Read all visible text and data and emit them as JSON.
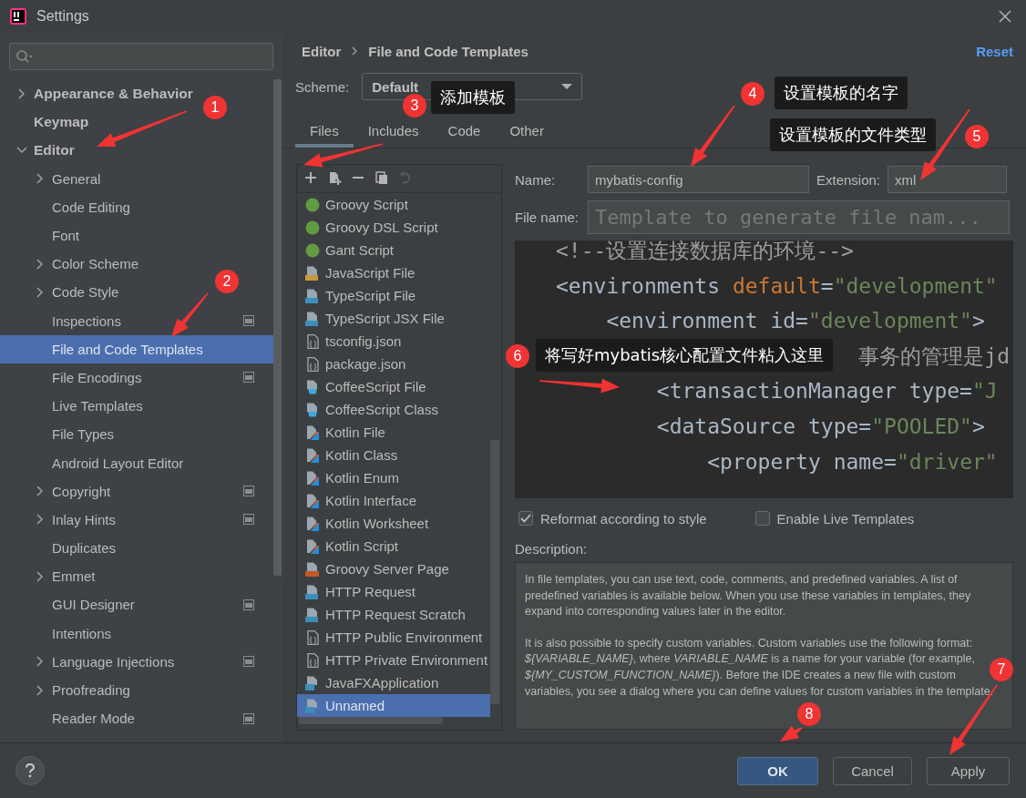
{
  "window": {
    "title": "Settings"
  },
  "sidebar": {
    "items": [
      {
        "label": "Appearance & Behavior",
        "expanded": false,
        "selected": false
      },
      {
        "label": "Keymap",
        "selected": false
      },
      {
        "label": "Editor",
        "expanded": true,
        "selected": false,
        "children": [
          {
            "label": "General",
            "expanded": false,
            "selected": false
          },
          {
            "label": "Code Editing",
            "selected": false
          },
          {
            "label": "Font",
            "selected": false
          },
          {
            "label": "Color Scheme",
            "expanded": false,
            "selected": false
          },
          {
            "label": "Code Style",
            "expanded": false,
            "selected": false
          },
          {
            "label": "Inspections",
            "selected": false,
            "project_scope": true
          },
          {
            "label": "File and Code Templates",
            "selected": true
          },
          {
            "label": "File Encodings",
            "selected": false,
            "project_scope": true
          },
          {
            "label": "Live Templates",
            "selected": false
          },
          {
            "label": "File Types",
            "selected": false
          },
          {
            "label": "Android Layout Editor",
            "selected": false
          },
          {
            "label": "Copyright",
            "expanded": false,
            "selected": false,
            "project_scope": true
          },
          {
            "label": "Inlay Hints",
            "expanded": false,
            "selected": false,
            "project_scope": true
          },
          {
            "label": "Duplicates",
            "selected": false
          },
          {
            "label": "Emmet",
            "expanded": false,
            "selected": false
          },
          {
            "label": "GUI Designer",
            "selected": false,
            "project_scope": true
          },
          {
            "label": "Intentions",
            "selected": false
          },
          {
            "label": "Language Injections",
            "expanded": false,
            "selected": false,
            "project_scope": true
          },
          {
            "label": "Proofreading",
            "expanded": false,
            "selected": false
          },
          {
            "label": "Reader Mode",
            "selected": false,
            "project_scope": true
          }
        ]
      }
    ]
  },
  "breadcrumb": [
    "Editor",
    "File and Code Templates"
  ],
  "reset": "Reset",
  "scheme": {
    "label": "Scheme:",
    "value": "Default"
  },
  "tabs": [
    {
      "label": "Files",
      "selected": true
    },
    {
      "label": "Includes",
      "selected": false
    },
    {
      "label": "Code",
      "selected": false
    },
    {
      "label": "Other",
      "selected": false
    }
  ],
  "toolbar": [
    {
      "kind": "add",
      "disabled": false
    },
    {
      "kind": "add-child",
      "disabled": false
    },
    {
      "kind": "remove",
      "disabled": false
    },
    {
      "kind": "copy",
      "disabled": false
    },
    {
      "kind": "reset",
      "disabled": true
    }
  ],
  "templates": [
    {
      "label": "Groovy Script",
      "kind": "groovy",
      "selected": false
    },
    {
      "label": "Groovy DSL Script",
      "kind": "groovy",
      "selected": false
    },
    {
      "label": "Gant Script",
      "kind": "groovy",
      "selected": false
    },
    {
      "label": "JavaScript File",
      "kind": "js",
      "selected": false
    },
    {
      "label": "TypeScript File",
      "kind": "ts",
      "selected": false
    },
    {
      "label": "TypeScript JSX File",
      "kind": "ts",
      "selected": false
    },
    {
      "label": "tsconfig.json",
      "kind": "json",
      "selected": false
    },
    {
      "label": "package.json",
      "kind": "json",
      "selected": false
    },
    {
      "label": "CoffeeScript File",
      "kind": "coffee",
      "selected": false
    },
    {
      "label": "CoffeeScript Class",
      "kind": "coffee",
      "selected": false
    },
    {
      "label": "Kotlin File",
      "kind": "kotlin",
      "selected": false
    },
    {
      "label": "Kotlin Class",
      "kind": "kotlin",
      "selected": false
    },
    {
      "label": "Kotlin Enum",
      "kind": "kotlin",
      "selected": false
    },
    {
      "label": "Kotlin Interface",
      "kind": "kotlin",
      "selected": false
    },
    {
      "label": "Kotlin Worksheet",
      "kind": "kotlin",
      "selected": false
    },
    {
      "label": "Kotlin Script",
      "kind": "kotlin",
      "selected": false
    },
    {
      "label": "Groovy Server Page",
      "kind": "gsp",
      "selected": false
    },
    {
      "label": "HTTP Request",
      "kind": "api",
      "selected": false
    },
    {
      "label": "HTTP Request Scratch",
      "kind": "api",
      "selected": false
    },
    {
      "label": "HTTP Public Environment",
      "kind": "json",
      "selected": false
    },
    {
      "label": "HTTP Private Environment",
      "kind": "json",
      "selected": false
    },
    {
      "label": "JavaFXApplication",
      "kind": "java",
      "selected": false
    },
    {
      "label": "Unnamed",
      "kind": "java",
      "selected": true
    }
  ],
  "name_field": {
    "label": "Name:",
    "value": "mybatis-config"
  },
  "extension_field": {
    "label": "Extension:",
    "value": "xml"
  },
  "file_name_field": {
    "label": "File name:",
    "placeholder": "Template to generate file nam..."
  },
  "code_lines": [
    {
      "tokens": [
        {
          "kind": "comment",
          "text": "<!--设置连接数据库的环境-->"
        }
      ]
    },
    {
      "tokens": [
        {
          "kind": "tag",
          "text": "<environments "
        },
        {
          "kind": "attr",
          "text": "default"
        },
        {
          "kind": "tag",
          "text": "="
        },
        {
          "kind": "string",
          "text": "\"development\""
        }
      ]
    },
    {
      "tokens": [
        {
          "kind": "tag",
          "text": "    <environment id="
        },
        {
          "kind": "string",
          "text": "\"development\""
        },
        {
          "kind": "tag",
          "text": ">"
        }
      ]
    },
    {
      "tokens": [
        {
          "kind": "comment",
          "text": "                        事务的管理是jd"
        }
      ]
    },
    {
      "tokens": [
        {
          "kind": "tag",
          "text": "        <transactionManager type="
        },
        {
          "kind": "string",
          "text": "\"J"
        }
      ]
    },
    {
      "tokens": [
        {
          "kind": "tag",
          "text": "        <dataSource type="
        },
        {
          "kind": "string",
          "text": "\"POOLED\""
        },
        {
          "kind": "tag",
          "text": ">"
        }
      ]
    },
    {
      "tokens": [
        {
          "kind": "tag",
          "text": "            <property name="
        },
        {
          "kind": "string",
          "text": "\"driver\""
        }
      ]
    }
  ],
  "options": [
    {
      "label": "Reformat according to style",
      "checked": true
    },
    {
      "label": "Enable Live Templates",
      "checked": false
    }
  ],
  "description": {
    "label": "Description:",
    "paragraphs": [
      "In file templates, you can use text, code, comments, and predefined variables. A list of predefined variables is available below. When you use these variables in templates, they expand into corresponding values later in the editor.",
      "It is also possible to specify custom variables. Custom variables use the following format: *${VARIABLE_NAME}*, where *VARIABLE_NAME* is a name for your variable (for example, *${MY_CUSTOM_FUNCTION_NAME}*). Before the IDE creates a new file with custom variables, you see a dialog where you can define values for custom variables in the template."
    ]
  },
  "buttons": [
    {
      "label": "OK",
      "default": true
    },
    {
      "label": "Cancel",
      "default": false
    },
    {
      "label": "Apply",
      "default": false
    }
  ],
  "annotations": [
    {
      "number": "1"
    },
    {
      "number": "2"
    },
    {
      "number": "3",
      "note": "添加模板"
    },
    {
      "number": "4",
      "note": "设置模板的名字"
    },
    {
      "number": "5",
      "note": "设置模板的文件类型"
    },
    {
      "number": "6",
      "note": "将写好mybatis核心配置文件粘入这里"
    },
    {
      "number": "7"
    },
    {
      "number": "8"
    }
  ]
}
